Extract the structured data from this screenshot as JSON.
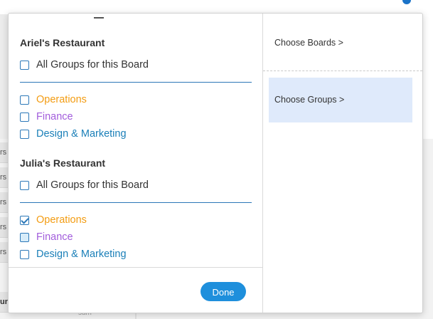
{
  "background": {
    "row_fragments": [
      "rs",
      "rs",
      "rs",
      "rs",
      "rs",
      "ur"
    ],
    "sum_label": "sum"
  },
  "popover": {
    "boards": [
      {
        "title": "Ariel's Restaurant",
        "all_groups_label": "All Groups for this Board",
        "all_groups_checked": false,
        "groups": [
          {
            "label": "Operations",
            "color": "#f39c12",
            "checked": false
          },
          {
            "label": "Finance",
            "color": "#a25ddc",
            "checked": false
          },
          {
            "label": "Design & Marketing",
            "color": "#1a7fb8",
            "checked": false
          }
        ]
      },
      {
        "title": "Julia's Restaurant",
        "all_groups_label": "All Groups for this Board",
        "all_groups_checked": false,
        "groups": [
          {
            "label": "Operations",
            "color": "#f39c12",
            "checked": true
          },
          {
            "label": "Finance",
            "color": "#a25ddc",
            "checked": false
          },
          {
            "label": "Design & Marketing",
            "color": "#1a7fb8",
            "checked": false
          }
        ]
      }
    ],
    "done_label": "Done",
    "nav": {
      "choose_boards": "Choose Boards >",
      "choose_groups": "Choose Groups >"
    }
  }
}
